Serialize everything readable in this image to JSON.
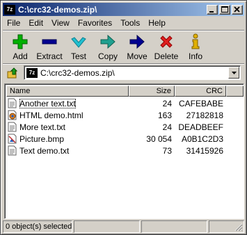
{
  "window": {
    "title": "C:\\crc32-demos.zip\\",
    "icon_text": "7z"
  },
  "menu": [
    "File",
    "Edit",
    "View",
    "Favorites",
    "Tools",
    "Help"
  ],
  "toolbar": [
    {
      "label": "Add",
      "icon": "plus-icon",
      "color": "#00b000"
    },
    {
      "label": "Extract",
      "icon": "minus-icon",
      "color": "#000090"
    },
    {
      "label": "Test",
      "icon": "check-icon",
      "color": "#20c0d0"
    },
    {
      "label": "Copy",
      "icon": "copy-arrow-icon",
      "color": "#20a090"
    },
    {
      "label": "Move",
      "icon": "move-arrow-icon",
      "color": "#000090"
    },
    {
      "label": "Delete",
      "icon": "delete-x-icon",
      "color": "#e02020"
    },
    {
      "label": "Info",
      "icon": "info-icon",
      "color": "#e0b000"
    }
  ],
  "address": {
    "value": "C:\\crc32-demos.zip\\",
    "icon_text": "7z"
  },
  "columns": {
    "name": "Name",
    "size": "Size",
    "crc": "CRC"
  },
  "files": [
    {
      "name": "Another text.txt",
      "size": "24",
      "crc": "CAFEBABE",
      "icon": "text-file-icon"
    },
    {
      "name": "HTML demo.html",
      "size": "163",
      "crc": "27182818",
      "icon": "html-file-icon"
    },
    {
      "name": "More text.txt",
      "size": "24",
      "crc": "DEADBEEF",
      "icon": "text-file-icon"
    },
    {
      "name": "Picture.bmp",
      "size": "30 054",
      "crc": "A0B1C2D3",
      "icon": "image-file-icon"
    },
    {
      "name": "Text demo.txt",
      "size": "73",
      "crc": "31415926",
      "icon": "text-file-icon"
    }
  ],
  "status": {
    "selection": "0 object(s) selected"
  }
}
